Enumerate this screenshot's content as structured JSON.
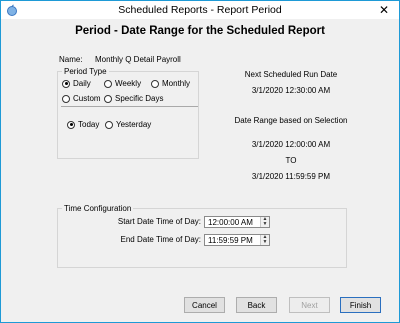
{
  "window": {
    "title": "Scheduled Reports - Report Period",
    "close_glyph": "✕"
  },
  "heading": "Period - Date Range for the Scheduled Report",
  "name": {
    "label": "Name:",
    "value": "Monthly Q Detail Payroll"
  },
  "period_type": {
    "legend": "Period Type",
    "options": [
      {
        "label": "Daily",
        "checked": true
      },
      {
        "label": "Weekly",
        "checked": false
      },
      {
        "label": "Monthly",
        "checked": false
      },
      {
        "label": "Custom",
        "checked": false
      },
      {
        "label": "Specific Days",
        "checked": false
      }
    ],
    "relative": [
      {
        "label": "Today",
        "checked": true
      },
      {
        "label": "Yesterday",
        "checked": false
      }
    ]
  },
  "next_run": {
    "label": "Next Scheduled Run Date",
    "value": "3/1/2020 12:30:00 AM"
  },
  "date_range": {
    "label": "Date Range based on Selection",
    "start": "3/1/2020 12:00:00 AM",
    "to": "TO",
    "end": "3/1/2020 11:59:59 PM"
  },
  "time_config": {
    "legend": "Time Configuration",
    "start_label": "Start Date Time of Day:",
    "start_value": "12:00:00 AM",
    "end_label": "End Date Time of Day:",
    "end_value": "11:59:59 PM"
  },
  "buttons": {
    "cancel": "Cancel",
    "back": "Back",
    "next": "Next",
    "finish": "Finish"
  },
  "colors": {
    "window_border": "#1e9ad6",
    "background": "#f0f0f0",
    "default_button_border": "#2a6fbf"
  }
}
